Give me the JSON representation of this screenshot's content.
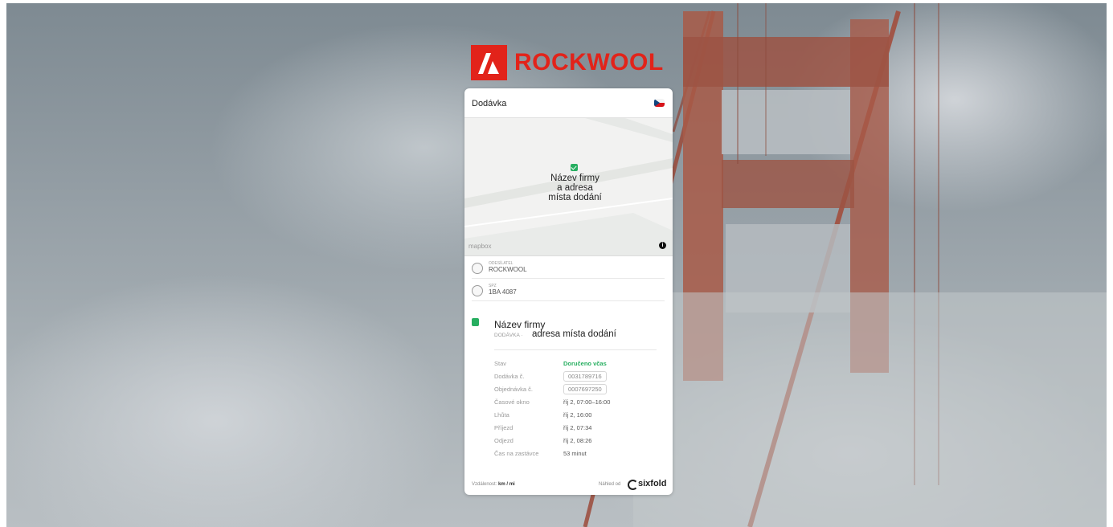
{
  "brand": {
    "logo_text": "ROCKWOOL",
    "color": "#e2231a"
  },
  "card": {
    "title": "Dodávka",
    "language_flag": "czech-flag-icon",
    "map": {
      "label_lines": [
        "Název firmy",
        "a adresa",
        "místa dodání"
      ],
      "attribution": "mapbox",
      "info_icon": "i"
    },
    "shipper": {
      "label": "ODESÍLATEL",
      "value": "ROCKWOOL"
    },
    "vehicle": {
      "label": "SPZ",
      "value": "1BA 4087"
    },
    "destination": {
      "name": "Název firmy",
      "type_label": "DODÁVKA ·",
      "address": "adresa místa dodání"
    },
    "details": [
      {
        "label": "Stav",
        "value": "Doručeno včas",
        "style": "green"
      },
      {
        "label": "Dodávka č.",
        "value": "0031789716",
        "style": "pill"
      },
      {
        "label": "Objednávka č.",
        "value": "0007697250",
        "style": "pill"
      },
      {
        "label": "Časové okno",
        "value": "říj 2, 07:00–16:00",
        "style": ""
      },
      {
        "label": "Lhůta",
        "value": "říj 2, 16:00",
        "style": ""
      },
      {
        "label": "Příjezd",
        "value": "říj 2, 07:34",
        "style": ""
      },
      {
        "label": "Odjezd",
        "value": "říj 2, 08:26",
        "style": ""
      },
      {
        "label": "Čas na zastávce",
        "value": "53 minut",
        "style": ""
      }
    ],
    "footer": {
      "distance_label": "Vzdálenost:",
      "distance_units": "km / mi",
      "powered_by": "Náhled od",
      "provider": "sixfold"
    }
  },
  "colors": {
    "status_green": "#27ae60"
  }
}
